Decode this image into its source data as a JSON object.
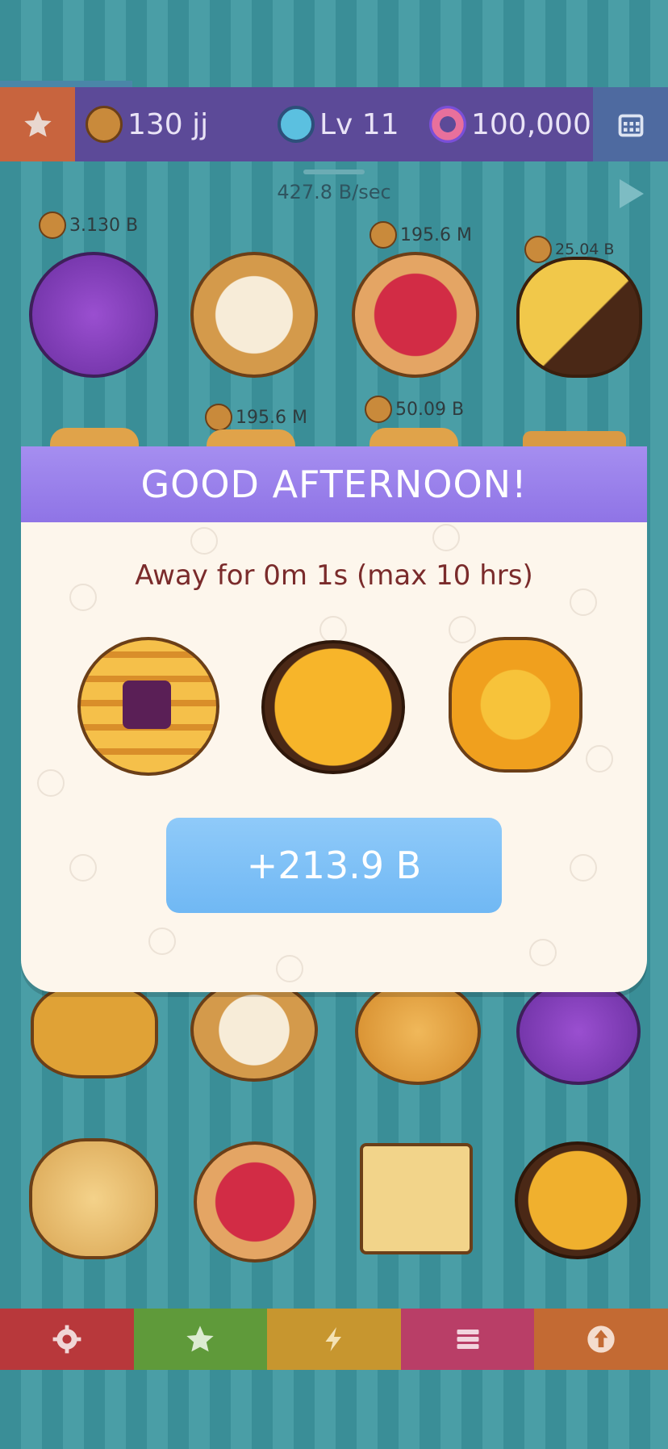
{
  "header": {
    "cookie_count": "130 jj",
    "level": "Lv 11",
    "donuts": "100,000"
  },
  "rate": "427.8 B/sec",
  "board_labels": [
    "3.130 B",
    "195.6 M",
    "25.04 B",
    "195.6 M",
    "50.09 B"
  ],
  "modal": {
    "title": "GOOD AFTERNOON!",
    "away_text": "Away for 0m 1s (max 10 hrs)",
    "reward_label": "+213.9 B"
  },
  "bottom_tabs": [
    {
      "icon": "gear-icon",
      "color": "#b8383b"
    },
    {
      "icon": "star-icon",
      "color": "#5f9a3a"
    },
    {
      "icon": "lightning-icon",
      "color": "#c7962f"
    },
    {
      "icon": "menu-icon",
      "color": "#b93e67"
    },
    {
      "icon": "upgrade-arrow-icon",
      "color": "#c36a33"
    }
  ]
}
